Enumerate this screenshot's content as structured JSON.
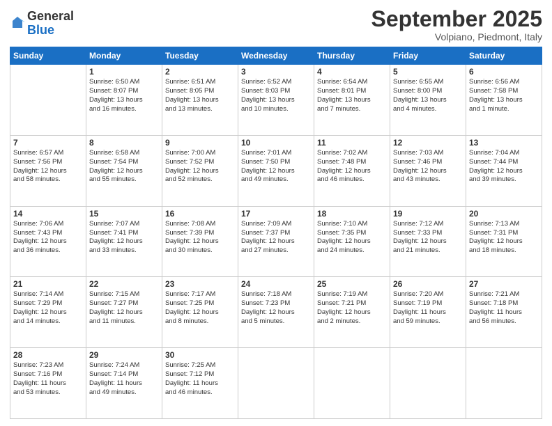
{
  "header": {
    "logo_general": "General",
    "logo_blue": "Blue",
    "month_title": "September 2025",
    "subtitle": "Volpiano, Piedmont, Italy"
  },
  "weekdays": [
    "Sunday",
    "Monday",
    "Tuesday",
    "Wednesday",
    "Thursday",
    "Friday",
    "Saturday"
  ],
  "weeks": [
    [
      {
        "day": "",
        "lines": []
      },
      {
        "day": "1",
        "lines": [
          "Sunrise: 6:50 AM",
          "Sunset: 8:07 PM",
          "Daylight: 13 hours",
          "and 16 minutes."
        ]
      },
      {
        "day": "2",
        "lines": [
          "Sunrise: 6:51 AM",
          "Sunset: 8:05 PM",
          "Daylight: 13 hours",
          "and 13 minutes."
        ]
      },
      {
        "day": "3",
        "lines": [
          "Sunrise: 6:52 AM",
          "Sunset: 8:03 PM",
          "Daylight: 13 hours",
          "and 10 minutes."
        ]
      },
      {
        "day": "4",
        "lines": [
          "Sunrise: 6:54 AM",
          "Sunset: 8:01 PM",
          "Daylight: 13 hours",
          "and 7 minutes."
        ]
      },
      {
        "day": "5",
        "lines": [
          "Sunrise: 6:55 AM",
          "Sunset: 8:00 PM",
          "Daylight: 13 hours",
          "and 4 minutes."
        ]
      },
      {
        "day": "6",
        "lines": [
          "Sunrise: 6:56 AM",
          "Sunset: 7:58 PM",
          "Daylight: 13 hours",
          "and 1 minute."
        ]
      }
    ],
    [
      {
        "day": "7",
        "lines": [
          "Sunrise: 6:57 AM",
          "Sunset: 7:56 PM",
          "Daylight: 12 hours",
          "and 58 minutes."
        ]
      },
      {
        "day": "8",
        "lines": [
          "Sunrise: 6:58 AM",
          "Sunset: 7:54 PM",
          "Daylight: 12 hours",
          "and 55 minutes."
        ]
      },
      {
        "day": "9",
        "lines": [
          "Sunrise: 7:00 AM",
          "Sunset: 7:52 PM",
          "Daylight: 12 hours",
          "and 52 minutes."
        ]
      },
      {
        "day": "10",
        "lines": [
          "Sunrise: 7:01 AM",
          "Sunset: 7:50 PM",
          "Daylight: 12 hours",
          "and 49 minutes."
        ]
      },
      {
        "day": "11",
        "lines": [
          "Sunrise: 7:02 AM",
          "Sunset: 7:48 PM",
          "Daylight: 12 hours",
          "and 46 minutes."
        ]
      },
      {
        "day": "12",
        "lines": [
          "Sunrise: 7:03 AM",
          "Sunset: 7:46 PM",
          "Daylight: 12 hours",
          "and 43 minutes."
        ]
      },
      {
        "day": "13",
        "lines": [
          "Sunrise: 7:04 AM",
          "Sunset: 7:44 PM",
          "Daylight: 12 hours",
          "and 39 minutes."
        ]
      }
    ],
    [
      {
        "day": "14",
        "lines": [
          "Sunrise: 7:06 AM",
          "Sunset: 7:43 PM",
          "Daylight: 12 hours",
          "and 36 minutes."
        ]
      },
      {
        "day": "15",
        "lines": [
          "Sunrise: 7:07 AM",
          "Sunset: 7:41 PM",
          "Daylight: 12 hours",
          "and 33 minutes."
        ]
      },
      {
        "day": "16",
        "lines": [
          "Sunrise: 7:08 AM",
          "Sunset: 7:39 PM",
          "Daylight: 12 hours",
          "and 30 minutes."
        ]
      },
      {
        "day": "17",
        "lines": [
          "Sunrise: 7:09 AM",
          "Sunset: 7:37 PM",
          "Daylight: 12 hours",
          "and 27 minutes."
        ]
      },
      {
        "day": "18",
        "lines": [
          "Sunrise: 7:10 AM",
          "Sunset: 7:35 PM",
          "Daylight: 12 hours",
          "and 24 minutes."
        ]
      },
      {
        "day": "19",
        "lines": [
          "Sunrise: 7:12 AM",
          "Sunset: 7:33 PM",
          "Daylight: 12 hours",
          "and 21 minutes."
        ]
      },
      {
        "day": "20",
        "lines": [
          "Sunrise: 7:13 AM",
          "Sunset: 7:31 PM",
          "Daylight: 12 hours",
          "and 18 minutes."
        ]
      }
    ],
    [
      {
        "day": "21",
        "lines": [
          "Sunrise: 7:14 AM",
          "Sunset: 7:29 PM",
          "Daylight: 12 hours",
          "and 14 minutes."
        ]
      },
      {
        "day": "22",
        "lines": [
          "Sunrise: 7:15 AM",
          "Sunset: 7:27 PM",
          "Daylight: 12 hours",
          "and 11 minutes."
        ]
      },
      {
        "day": "23",
        "lines": [
          "Sunrise: 7:17 AM",
          "Sunset: 7:25 PM",
          "Daylight: 12 hours",
          "and 8 minutes."
        ]
      },
      {
        "day": "24",
        "lines": [
          "Sunrise: 7:18 AM",
          "Sunset: 7:23 PM",
          "Daylight: 12 hours",
          "and 5 minutes."
        ]
      },
      {
        "day": "25",
        "lines": [
          "Sunrise: 7:19 AM",
          "Sunset: 7:21 PM",
          "Daylight: 12 hours",
          "and 2 minutes."
        ]
      },
      {
        "day": "26",
        "lines": [
          "Sunrise: 7:20 AM",
          "Sunset: 7:19 PM",
          "Daylight: 11 hours",
          "and 59 minutes."
        ]
      },
      {
        "day": "27",
        "lines": [
          "Sunrise: 7:21 AM",
          "Sunset: 7:18 PM",
          "Daylight: 11 hours",
          "and 56 minutes."
        ]
      }
    ],
    [
      {
        "day": "28",
        "lines": [
          "Sunrise: 7:23 AM",
          "Sunset: 7:16 PM",
          "Daylight: 11 hours",
          "and 53 minutes."
        ]
      },
      {
        "day": "29",
        "lines": [
          "Sunrise: 7:24 AM",
          "Sunset: 7:14 PM",
          "Daylight: 11 hours",
          "and 49 minutes."
        ]
      },
      {
        "day": "30",
        "lines": [
          "Sunrise: 7:25 AM",
          "Sunset: 7:12 PM",
          "Daylight: 11 hours",
          "and 46 minutes."
        ]
      },
      {
        "day": "",
        "lines": []
      },
      {
        "day": "",
        "lines": []
      },
      {
        "day": "",
        "lines": []
      },
      {
        "day": "",
        "lines": []
      }
    ]
  ]
}
